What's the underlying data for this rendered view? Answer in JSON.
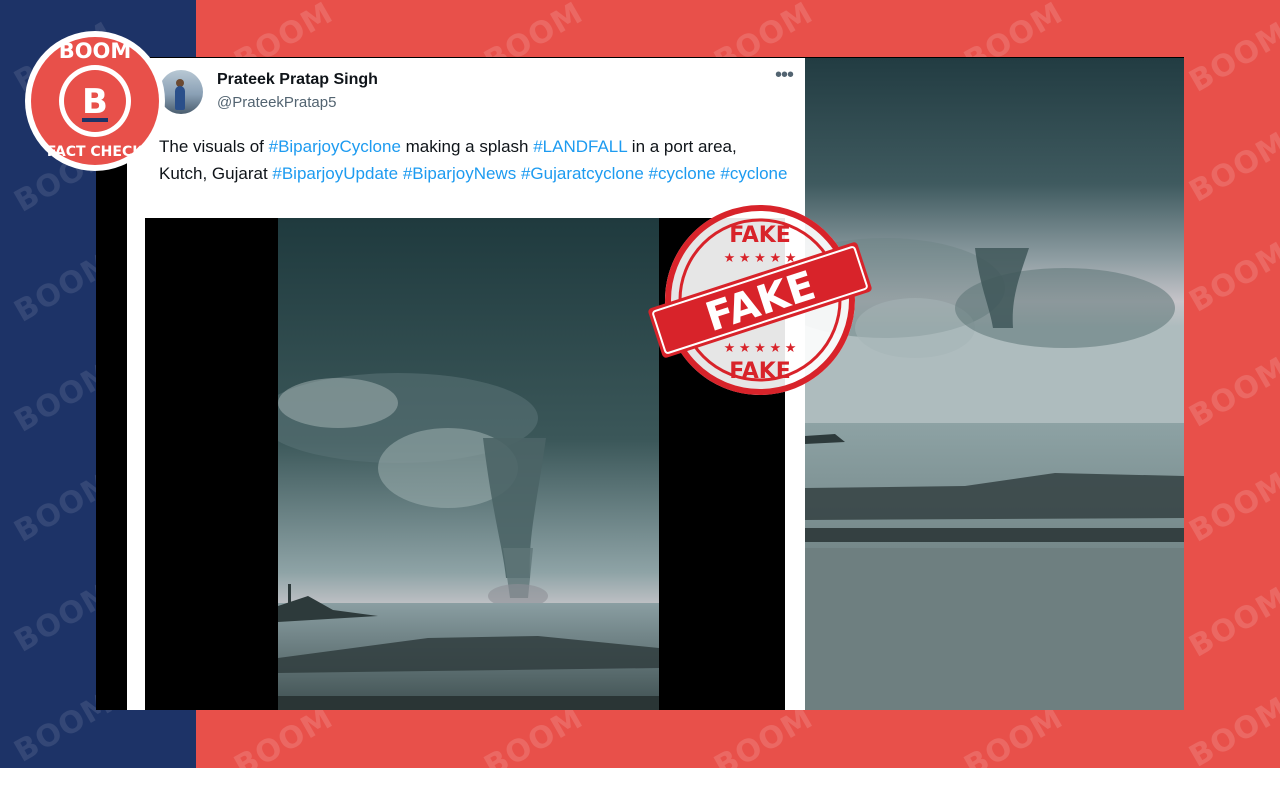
{
  "brand": {
    "badge_top": "BOOM",
    "badge_letter": "B",
    "badge_bottom": "FACT CHECK",
    "watermark": "BOOM",
    "colors": {
      "navy": "#1d3367",
      "red": "#e8504a",
      "link": "#1d9bf0"
    }
  },
  "tweet": {
    "author_name": "Prateek Pratap Singh",
    "author_handle": "@PrateekPratap5",
    "more_icon": "ellipsis-icon",
    "text": {
      "t1": "The visuals of ",
      "h1": "#BiparjoyCyclone",
      "t2": " making a splash ",
      "h2": "#LANDFALL",
      "t3": " in a port area, Kutch, Gujarat  ",
      "h3": "#BiparjoyUpdate",
      "h4": "#BiparjoyNews",
      "h5": "#Gujaratcyclone",
      "h6": "#cyclone",
      "h7": "#cyclone"
    }
  },
  "stamp": {
    "top": "FAKE",
    "center": "FAKE",
    "bottom": "FAKE"
  }
}
